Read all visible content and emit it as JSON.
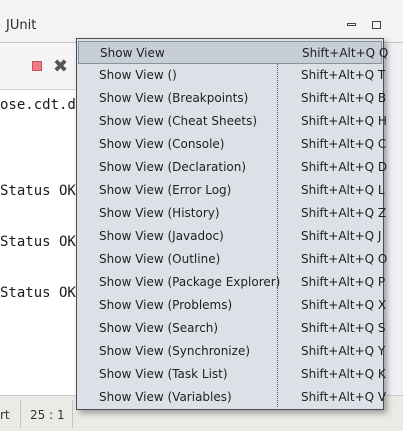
{
  "view": {
    "tab_title": "JUnit"
  },
  "toolbar": {
    "stop_icon": "stop-icon",
    "clear_icon": "remove-all-icon"
  },
  "console": {
    "lines": [
      "ose.cdt.ds",
      "Status OK:",
      "Status OK:",
      "Status OK:"
    ]
  },
  "status_bar": {
    "left": "rt",
    "position": "25 : 1"
  },
  "menu": {
    "items": [
      {
        "label": "Show View",
        "shortcut": "Shift+Alt+Q Q",
        "selected": true
      },
      {
        "label": "Show View ()",
        "shortcut": "Shift+Alt+Q T"
      },
      {
        "label": "Show View (Breakpoints)",
        "shortcut": "Shift+Alt+Q B"
      },
      {
        "label": "Show View (Cheat Sheets)",
        "shortcut": "Shift+Alt+Q H"
      },
      {
        "label": "Show View (Console)",
        "shortcut": "Shift+Alt+Q C"
      },
      {
        "label": "Show View (Declaration)",
        "shortcut": "Shift+Alt+Q D"
      },
      {
        "label": "Show View (Error Log)",
        "shortcut": "Shift+Alt+Q L"
      },
      {
        "label": "Show View (History)",
        "shortcut": "Shift+Alt+Q Z"
      },
      {
        "label": "Show View (Javadoc)",
        "shortcut": "Shift+Alt+Q J"
      },
      {
        "label": "Show View (Outline)",
        "shortcut": "Shift+Alt+Q O"
      },
      {
        "label": "Show View (Package Explorer)",
        "shortcut": "Shift+Alt+Q P"
      },
      {
        "label": "Show View (Problems)",
        "shortcut": "Shift+Alt+Q X"
      },
      {
        "label": "Show View (Search)",
        "shortcut": "Shift+Alt+Q S"
      },
      {
        "label": "Show View (Synchronize)",
        "shortcut": "Shift+Alt+Q Y"
      },
      {
        "label": "Show View (Task List)",
        "shortcut": "Shift+Alt+Q K"
      },
      {
        "label": "Show View (Variables)",
        "shortcut": "Shift+Alt+Q V"
      }
    ]
  }
}
